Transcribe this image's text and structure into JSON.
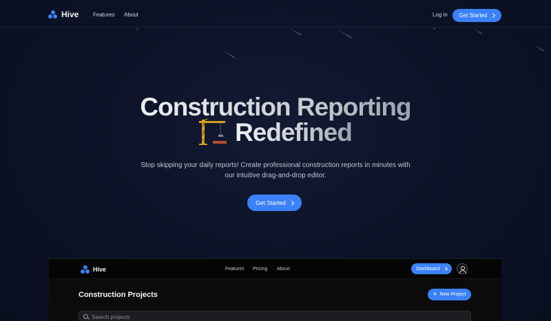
{
  "nav": {
    "brand": "Hive",
    "links": [
      "Features",
      "About"
    ],
    "login": "Log in",
    "cta": "Get Started"
  },
  "hero": {
    "title_line1": "Construction Reporting",
    "title_line2": "Redefined",
    "crane_icon": "construction-crane-icon",
    "subtitle": "Stop skipping your daily reports! Create professional construction reports in minutes with our intuitive drag-and-drop editor.",
    "cta": "Get Started"
  },
  "preview": {
    "brand": "Hive",
    "links": [
      "Features",
      "Pricing",
      "About"
    ],
    "dashboard": "Dashboard",
    "page_title": "Construction Projects",
    "new_project": "New Project",
    "search_placeholder": "Search projects"
  },
  "colors": {
    "accent": "#3b82f6",
    "background": "#0c1226",
    "preview_bg": "#0b0b0c"
  }
}
